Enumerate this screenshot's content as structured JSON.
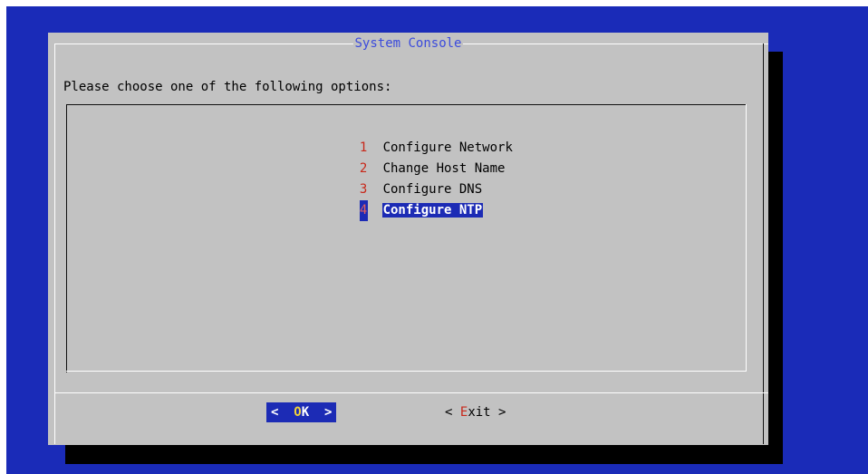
{
  "dialog": {
    "title": "System Console",
    "prompt": "Please choose one of the following options:"
  },
  "menu": {
    "items": [
      {
        "num": "1",
        "label": "Configure Network"
      },
      {
        "num": "2",
        "label": "Change Host Name"
      },
      {
        "num": "3",
        "label": "Configure DNS"
      },
      {
        "num": "4",
        "label": "Configure NTP"
      }
    ],
    "selected": "4"
  },
  "buttons": {
    "ok": {
      "open": "<",
      "hotkey": "O",
      "rest": "K",
      "close": ">"
    },
    "exit": {
      "open": "<",
      "hotkey": "E",
      "rest": "xit",
      "close": ">"
    }
  },
  "colors": {
    "background": "#1a2bb8",
    "dialog": "#c2c2c2",
    "shadow": "#000000",
    "title": "#3b4bdc",
    "highlight": "#1c2bb5",
    "hotkey_red": "#c8281a",
    "hotkey_yellow": "#f1d23a"
  }
}
